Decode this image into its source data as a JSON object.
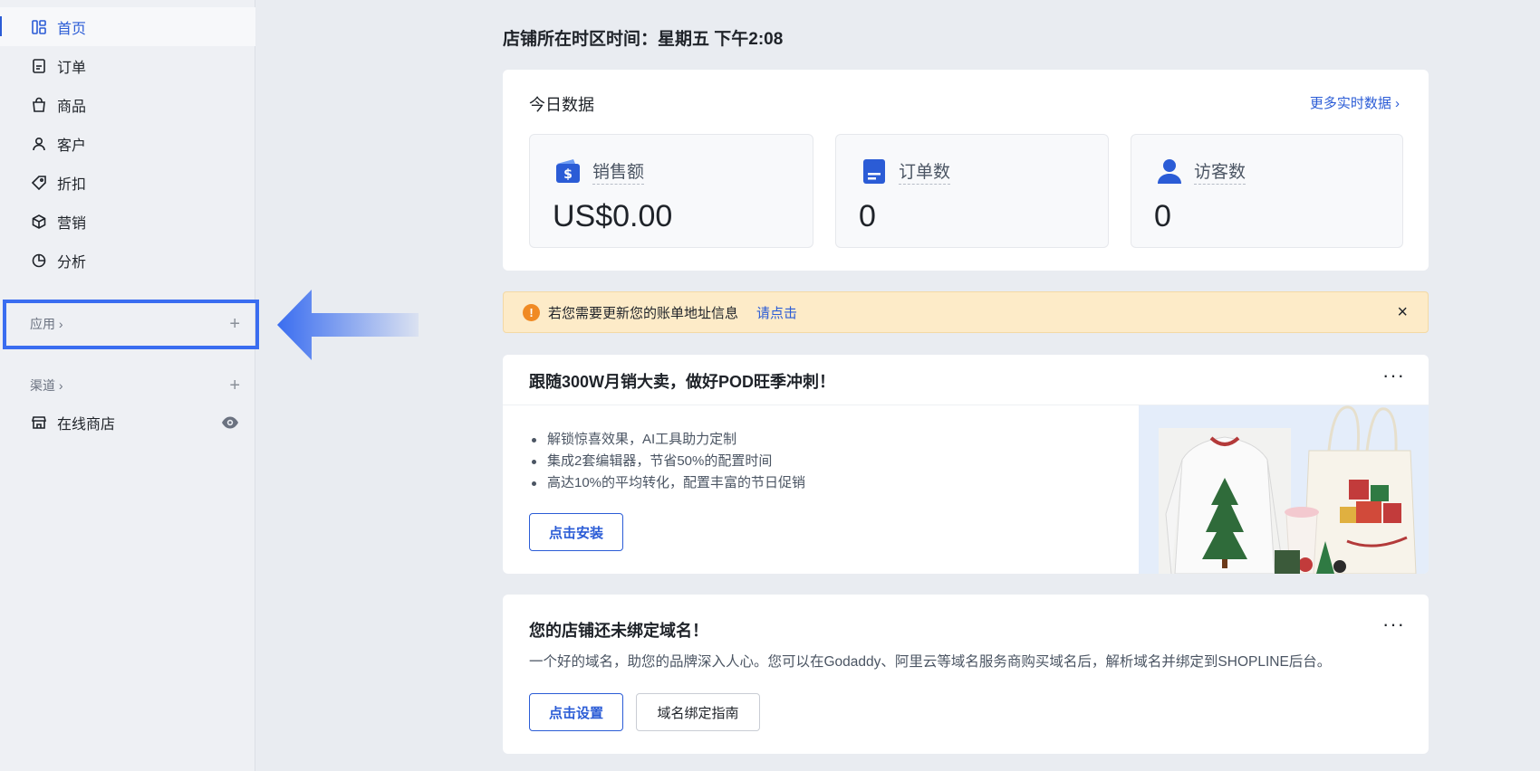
{
  "sidebar": {
    "items": [
      {
        "label": "首页",
        "icon": "dashboard-icon",
        "active": true
      },
      {
        "label": "订单",
        "icon": "order-icon"
      },
      {
        "label": "商品",
        "icon": "shopping-bag-icon"
      },
      {
        "label": "客户",
        "icon": "user-icon"
      },
      {
        "label": "折扣",
        "icon": "tag-icon"
      },
      {
        "label": "营销",
        "icon": "cube-icon"
      },
      {
        "label": "分析",
        "icon": "pie-chart-icon"
      }
    ],
    "apps_label": "应用 ›",
    "channels_label": "渠道 ›",
    "plus": "+",
    "store_label": "在线商店"
  },
  "main": {
    "timezone_text": "店铺所在时区时间：星期五 下午2:08",
    "today": {
      "title": "今日数据",
      "more_link": "更多实时数据 ›",
      "stats": [
        {
          "label": "销售额",
          "value": "US$0.00",
          "icon": "wallet-icon"
        },
        {
          "label": "订单数",
          "value": "0",
          "icon": "document-icon"
        },
        {
          "label": "访客数",
          "value": "0",
          "icon": "visitor-icon"
        }
      ]
    },
    "notice": {
      "icon": "!",
      "text": "若您需要更新您的账单地址信息",
      "link": "请点击",
      "close": "×"
    },
    "promo": {
      "title": "跟随300W月销大卖，做好POD旺季冲刺！",
      "more": "···",
      "bullets": [
        "解锁惊喜效果，AI工具助力定制",
        "集成2套编辑器，节省50%的配置时间",
        "高达10%的平均转化，配置丰富的节日促销"
      ],
      "button": "点击安装"
    },
    "domain": {
      "title": "您的店铺还未绑定域名！",
      "more": "···",
      "desc": "一个好的域名，助您的品牌深入人心。您可以在Godaddy、阿里云等域名服务商购买域名后，解析域名并绑定到SHOPLINE后台。",
      "primary_button": "点击设置",
      "secondary_button": "域名绑定指南"
    }
  },
  "colors": {
    "accent": "#2b5cd6",
    "highlight_box": "#3a6df0",
    "notice_bg": "#fdebc8",
    "warning": "#f08a24"
  }
}
